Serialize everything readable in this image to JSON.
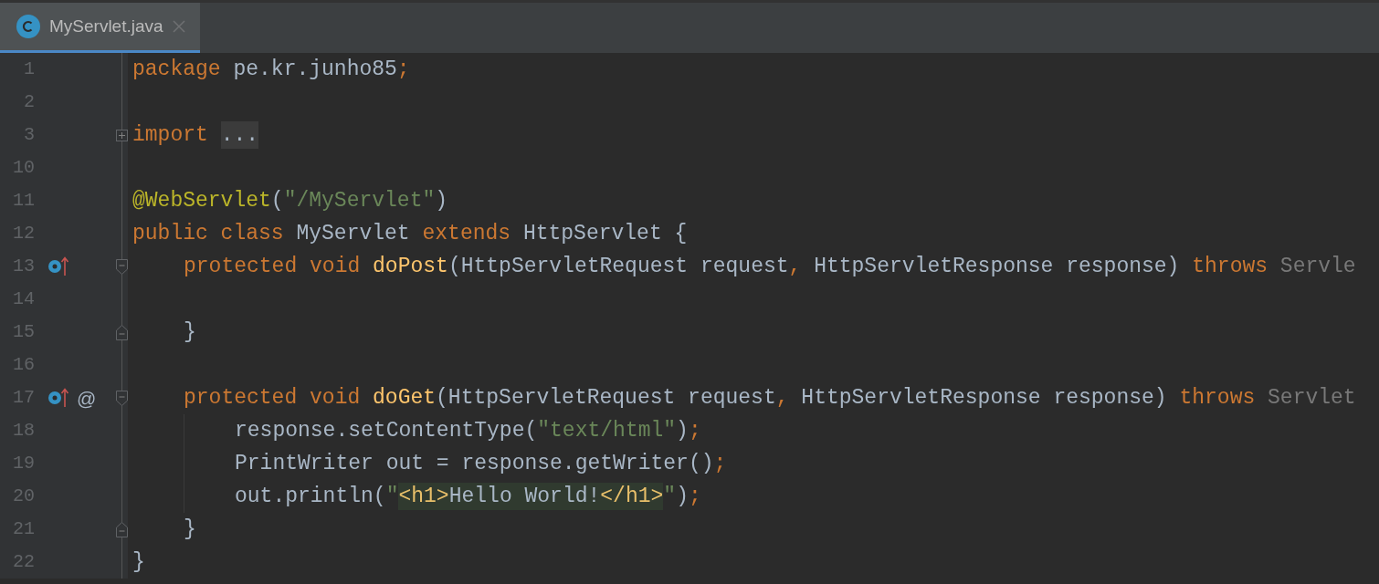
{
  "tabs": [
    {
      "label": "MyServlet.java",
      "selected": true
    }
  ],
  "lines": [
    {
      "number": "1",
      "tokens": [
        {
          "kind": "keyword",
          "text": "package"
        },
        {
          "kind": "plain",
          "text": " pe.kr.junho85"
        },
        {
          "kind": "punct",
          "text": ";"
        }
      ]
    },
    {
      "number": "2"
    },
    {
      "number": "3",
      "collapsed": true,
      "tokens": [
        {
          "kind": "keyword",
          "text": "import "
        },
        {
          "kind": "folded",
          "text": "..."
        }
      ]
    },
    {
      "number": "10"
    },
    {
      "number": "11",
      "tokens": [
        {
          "kind": "annotation",
          "text": "@WebServlet"
        },
        {
          "kind": "plain",
          "text": "("
        },
        {
          "kind": "string",
          "text": "\"/MyServlet\""
        },
        {
          "kind": "plain",
          "text": ")"
        }
      ]
    },
    {
      "number": "12",
      "tokens": [
        {
          "kind": "keyword",
          "text": "public class"
        },
        {
          "kind": "plain",
          "text": " MyServlet "
        },
        {
          "kind": "keyword",
          "text": "extends"
        },
        {
          "kind": "plain",
          "text": " HttpServlet {"
        }
      ],
      "children": [
        {
          "number": "13",
          "markers": [
            {
              "kind": "overrides"
            }
          ],
          "fold_start": true,
          "tokens": [
            {
              "kind": "keyword",
              "text": "protected void "
            },
            {
              "kind": "method",
              "text": "doPost"
            },
            {
              "kind": "plain",
              "text": "(HttpServletRequest request"
            },
            {
              "kind": "punct",
              "text": ","
            },
            {
              "kind": "plain",
              "text": " HttpServletResponse response) "
            },
            {
              "kind": "keyword",
              "text": "throws "
            },
            {
              "kind": "dim",
              "text": "Servle"
            }
          ]
        },
        {
          "number": "14"
        },
        {
          "number": "15",
          "fold_end": true,
          "tokens": [
            {
              "kind": "plain",
              "text": "}"
            }
          ]
        },
        {
          "number": "16"
        },
        {
          "number": "17",
          "markers": [
            {
              "kind": "overrides"
            },
            {
              "kind": "annotation",
              "text": "@"
            }
          ],
          "fold_start": true,
          "tokens": [
            {
              "kind": "keyword",
              "text": "protected void "
            },
            {
              "kind": "method",
              "text": "doGet"
            },
            {
              "kind": "plain",
              "text": "(HttpServletRequest request"
            },
            {
              "kind": "punct",
              "text": ","
            },
            {
              "kind": "plain",
              "text": " HttpServletResponse response) "
            },
            {
              "kind": "keyword",
              "text": "throws "
            },
            {
              "kind": "dim",
              "text": "Servlet"
            }
          ],
          "children": [
            {
              "number": "18",
              "tokens": [
                {
                  "kind": "plain",
                  "text": "response.setContentType("
                },
                {
                  "kind": "string",
                  "text": "\"text/html\""
                },
                {
                  "kind": "plain",
                  "text": ")"
                },
                {
                  "kind": "punct",
                  "text": ";"
                }
              ]
            },
            {
              "number": "19",
              "tokens": [
                {
                  "kind": "plain",
                  "text": "PrintWriter out = response.getWriter()"
                },
                {
                  "kind": "punct",
                  "text": ";"
                }
              ]
            },
            {
              "number": "20",
              "tokens": [
                {
                  "kind": "plain",
                  "text": "out.println("
                },
                {
                  "kind": "string",
                  "text": "\""
                },
                {
                  "kind": "tag",
                  "text": "<h1>"
                },
                {
                  "kind": "injected",
                  "text": "Hello World!"
                },
                {
                  "kind": "tag",
                  "text": "</h1>"
                },
                {
                  "kind": "string",
                  "text": "\""
                },
                {
                  "kind": "plain",
                  "text": ")"
                },
                {
                  "kind": "punct",
                  "text": ";"
                }
              ]
            }
          ]
        },
        {
          "number": "21",
          "fold_end": true,
          "tokens": [
            {
              "kind": "plain",
              "text": "}"
            }
          ]
        }
      ]
    },
    {
      "number": "22",
      "tokens": [
        {
          "kind": "plain",
          "text": "}"
        }
      ]
    }
  ]
}
